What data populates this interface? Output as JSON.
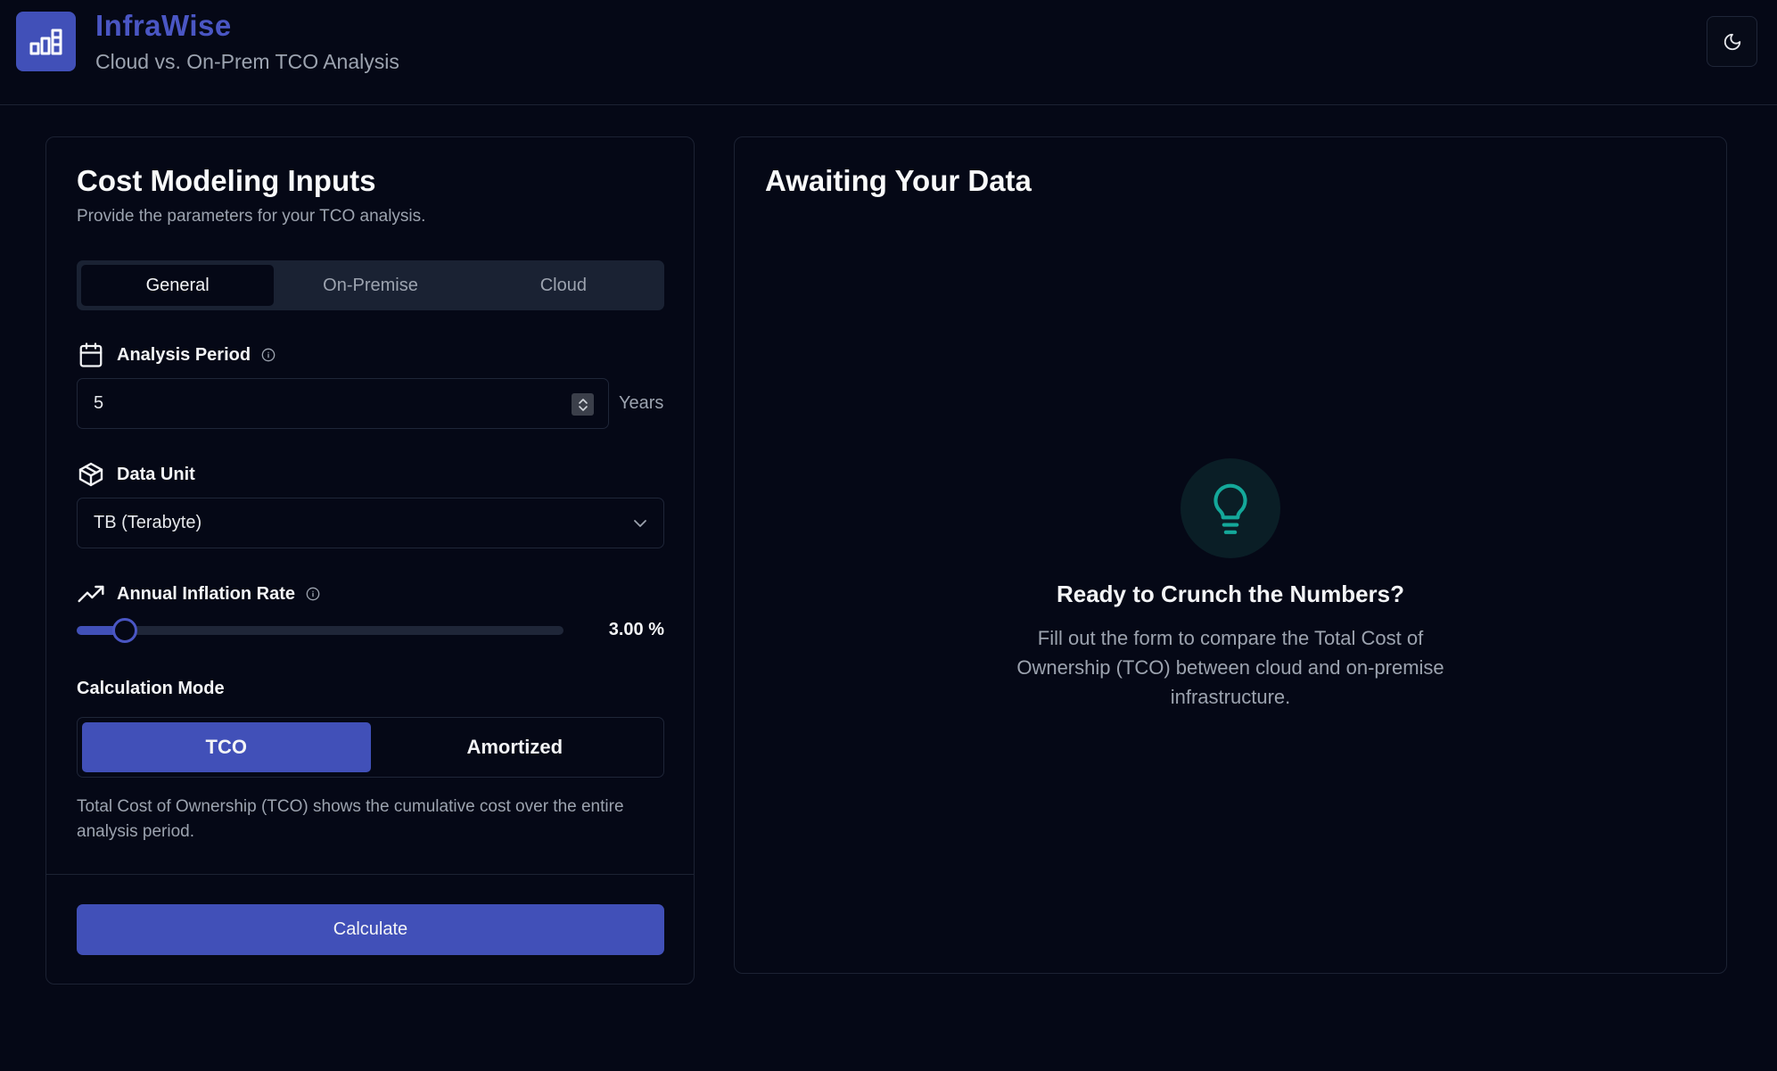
{
  "app": {
    "title": "InfraWise",
    "subtitle": "Cloud vs. On-Prem TCO Analysis",
    "logo_icon": "bar-chart-building-icon",
    "theme_toggle_icon": "moon-icon"
  },
  "colors": {
    "background": "#050816",
    "accent": "#4150b8",
    "brand_text": "#4a56c4",
    "muted_text": "#9ca3af",
    "teal_icon": "#14a89a"
  },
  "inputs_card": {
    "title": "Cost Modeling Inputs",
    "description": "Provide the parameters for your TCO analysis.",
    "tabs": [
      {
        "label": "General",
        "active": true
      },
      {
        "label": "On-Premise",
        "active": false
      },
      {
        "label": "Cloud",
        "active": false
      }
    ],
    "analysis_period": {
      "label": "Analysis Period",
      "icon": "calendar-icon",
      "value": "5",
      "unit": "Years"
    },
    "data_unit": {
      "label": "Data Unit",
      "icon": "box-icon",
      "selected": "TB (Terabyte)"
    },
    "inflation": {
      "label": "Annual Inflation Rate",
      "icon": "trending-up-icon",
      "value": 3.0,
      "max": 60,
      "display": "3.00 %"
    },
    "calculation_mode": {
      "label": "Calculation Mode",
      "options": [
        {
          "label": "TCO",
          "active": true
        },
        {
          "label": "Amortized",
          "active": false
        }
      ],
      "description": "Total Cost of Ownership (TCO) shows the cumulative cost over the entire analysis period."
    },
    "calculate_label": "Calculate"
  },
  "results_card": {
    "title": "Awaiting Your Data",
    "icon": "lightbulb-icon",
    "empty_title": "Ready to Crunch the Numbers?",
    "empty_description": "Fill out the form to compare the Total Cost of Ownership (TCO) between cloud and on-premise infrastructure."
  }
}
